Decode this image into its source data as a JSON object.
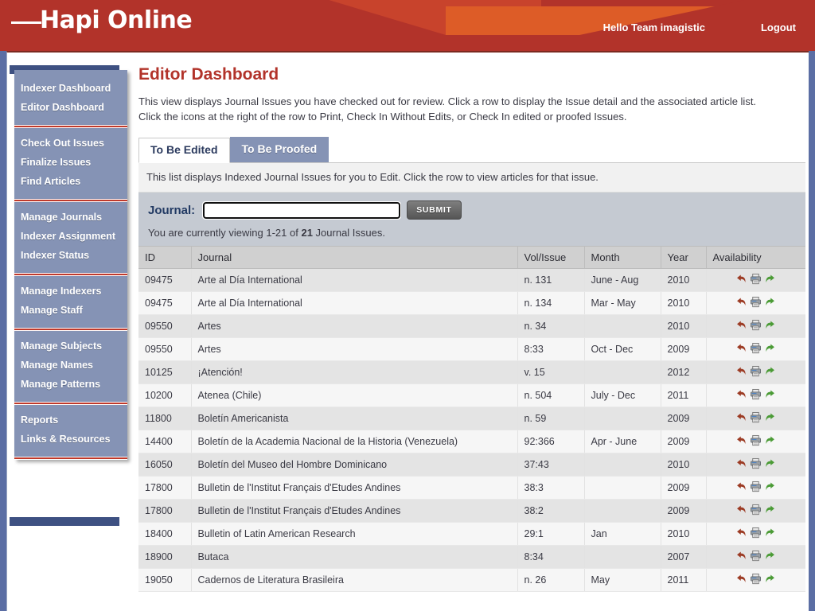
{
  "banner": {
    "logo_text": "Hapi Online",
    "logo_dash_icon": "horizontal-rule-icon",
    "greeting": "Hello Team imagistic",
    "logout_label": "Logout"
  },
  "sidebar": {
    "groups": [
      {
        "items": [
          {
            "label": "Indexer Dashboard",
            "name": "indexer-dashboard"
          },
          {
            "label": "Editor Dashboard",
            "name": "editor-dashboard"
          }
        ]
      },
      {
        "items": [
          {
            "label": "Check Out Issues",
            "name": "check-out-issues"
          },
          {
            "label": "Finalize Issues",
            "name": "finalize-issues"
          },
          {
            "label": "Find Articles",
            "name": "find-articles"
          }
        ]
      },
      {
        "items": [
          {
            "label": "Manage Journals",
            "name": "manage-journals"
          },
          {
            "label": "Indexer Assignment",
            "name": "indexer-assignment"
          },
          {
            "label": "Indexer Status",
            "name": "indexer-status"
          }
        ]
      },
      {
        "items": [
          {
            "label": "Manage Indexers",
            "name": "manage-indexers"
          },
          {
            "label": "Manage Staff",
            "name": "manage-staff"
          }
        ]
      },
      {
        "items": [
          {
            "label": "Manage Subjects",
            "name": "manage-subjects"
          },
          {
            "label": "Manage Names",
            "name": "manage-names"
          },
          {
            "label": "Manage Patterns",
            "name": "manage-patterns"
          }
        ]
      },
      {
        "items": [
          {
            "label": "Reports",
            "name": "reports"
          },
          {
            "label": "Links & Resources",
            "name": "links-and-resources"
          }
        ]
      }
    ]
  },
  "main": {
    "title": "Editor Dashboard",
    "intro_line_1": "This view displays Journal Issues you have checked out for review. Click a row to display the Issue detail and the associated article list.",
    "intro_line_2": "Click the icons at the right of the row to Print, Check In Without Edits, or Check In edited or proofed Issues.",
    "tabs": [
      {
        "label": "To Be Edited",
        "name": "to-be-edited",
        "active": true
      },
      {
        "label": "To Be Proofed",
        "name": "to-be-proofed",
        "active": false
      }
    ],
    "tab_description": "This list displays Indexed Journal Issues for you to Edit. Click the row to view articles for that issue.",
    "search": {
      "label": "Journal:",
      "value": "",
      "placeholder": "",
      "submit_label": "SUBMIT"
    },
    "viewing_prefix": "You are currently viewing 1-21 of ",
    "viewing_count": "21",
    "viewing_suffix": " Journal Issues."
  },
  "table": {
    "columns": [
      "ID",
      "Journal",
      "Vol/Issue",
      "Month",
      "Year",
      "Availability"
    ],
    "row_icons": [
      "check-in-without-edits-icon",
      "print-icon",
      "check-in-edited-icon"
    ],
    "rows": [
      {
        "id": "09475",
        "journal": "Arte al Día International",
        "vol": "n. 131",
        "month": "June - Aug",
        "year": "2010"
      },
      {
        "id": "09475",
        "journal": "Arte al Día International",
        "vol": "n. 134",
        "month": "Mar - May",
        "year": "2010"
      },
      {
        "id": "09550",
        "journal": "Artes",
        "vol": "n. 34",
        "month": "",
        "year": "2010"
      },
      {
        "id": "09550",
        "journal": "Artes",
        "vol": "8:33",
        "month": "Oct - Dec",
        "year": "2009"
      },
      {
        "id": "10125",
        "journal": "¡Atención!",
        "vol": "v. 15",
        "month": "",
        "year": "2012"
      },
      {
        "id": "10200",
        "journal": "Atenea (Chile)",
        "vol": "n. 504",
        "month": "July - Dec",
        "year": "2011"
      },
      {
        "id": "11800",
        "journal": "Boletín Americanista",
        "vol": "n. 59",
        "month": "",
        "year": "2009"
      },
      {
        "id": "14400",
        "journal": "Boletín de la Academia Nacional de la Historia (Venezuela)",
        "vol": "92:366",
        "month": "Apr - June",
        "year": "2009"
      },
      {
        "id": "16050",
        "journal": "Boletín del Museo del Hombre Dominicano",
        "vol": "37:43",
        "month": "",
        "year": "2010"
      },
      {
        "id": "17800",
        "journal": "Bulletin de l'Institut Français d'Etudes Andines",
        "vol": "38:3",
        "month": "",
        "year": "2009"
      },
      {
        "id": "17800",
        "journal": "Bulletin de l'Institut Français d'Etudes Andines",
        "vol": "38:2",
        "month": "",
        "year": "2009"
      },
      {
        "id": "18400",
        "journal": "Bulletin of Latin American Research",
        "vol": "29:1",
        "month": "Jan",
        "year": "2010"
      },
      {
        "id": "18900",
        "journal": "Butaca",
        "vol": "8:34",
        "month": "",
        "year": "2007"
      },
      {
        "id": "19050",
        "journal": "Cadernos de Literatura Brasileira",
        "vol": "n. 26",
        "month": "May",
        "year": "2011"
      }
    ]
  },
  "colors": {
    "brand_red": "#b2332a",
    "brand_orange": "#dd5c27",
    "sidebar_blue": "#8593b5",
    "sidebar_dark_blue": "#3e5182",
    "title_red": "#b2332a",
    "page_background": "#5b6ea4",
    "undo_icon": "#9c3b24",
    "redo_icon": "#4b9b36"
  }
}
